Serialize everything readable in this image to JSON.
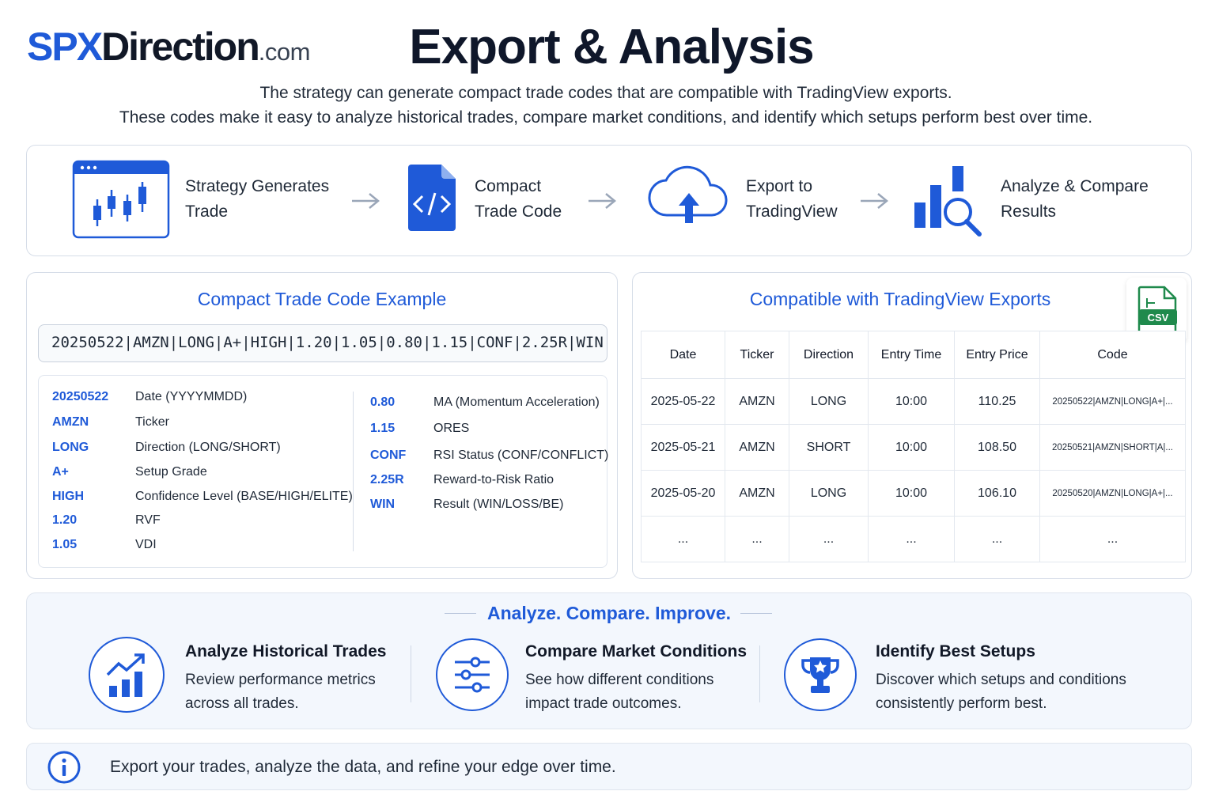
{
  "brand": {
    "part1": "SPX",
    "part2": "Direction",
    "part3": ".com"
  },
  "header": {
    "title": "Export & Analysis",
    "subtitle_line1": "The strategy can generate compact trade codes that are compatible with TradingView exports.",
    "subtitle_line2": "These codes make it easy to analyze historical trades, compare market conditions, and identify which setups perform best over time."
  },
  "flow": {
    "steps": [
      {
        "line1": "Strategy Generates",
        "line2": "Trade",
        "icon": "candlestick-chart-window-icon"
      },
      {
        "line1": "Compact",
        "line2": "Trade Code",
        "icon": "code-file-icon"
      },
      {
        "line1": "Export to",
        "line2": "TradingView",
        "icon": "cloud-upload-icon"
      },
      {
        "line1": "Analyze & Compare",
        "line2": "Results",
        "icon": "bar-chart-magnifier-icon"
      }
    ],
    "arrow_icon": "arrow-right-icon"
  },
  "code_example": {
    "title": "Compact Trade Code Example",
    "code": "20250522|AMZN|LONG|A+|HIGH|1.20|1.05|0.80|1.15|CONF|2.25R|WIN",
    "left_items": [
      {
        "key": "20250522",
        "desc": "Date (YYYYMMDD)"
      },
      {
        "key": "AMZN",
        "desc": "Ticker"
      },
      {
        "key": "LONG",
        "desc": "Direction (LONG/SHORT)"
      },
      {
        "key": "A+",
        "desc": "Setup Grade"
      },
      {
        "key": "HIGH",
        "desc": "Confidence Level (BASE/HIGH/ELITE)"
      },
      {
        "key": "1.20",
        "desc": "RVF"
      },
      {
        "key": "1.05",
        "desc": "VDI"
      }
    ],
    "right_items": [
      {
        "key": "0.80",
        "desc": "MA (Momentum Acceleration)"
      },
      {
        "key": "1.15",
        "desc": "ORES"
      },
      {
        "key": "CONF",
        "desc": "RSI Status (CONF/CONFLICT)"
      },
      {
        "key": "2.25R",
        "desc": "Reward-to-Risk Ratio"
      },
      {
        "key": "WIN",
        "desc": "Result (WIN/LOSS/BE)"
      }
    ]
  },
  "tv_export": {
    "title": "Compatible with TradingView Exports",
    "csv_label": "CSV",
    "columns": [
      "Date",
      "Ticker",
      "Direction",
      "Entry Time",
      "Entry Price",
      "Code"
    ],
    "rows": [
      [
        "2025-05-22",
        "AMZN",
        "LONG",
        "10:00",
        "110.25",
        "20250522|AMZN|LONG|A+|..."
      ],
      [
        "2025-05-21",
        "AMZN",
        "SHORT",
        "10:00",
        "108.50",
        "20250521|AMZN|SHORT|A|..."
      ],
      [
        "2025-05-20",
        "AMZN",
        "LONG",
        "10:00",
        "106.10",
        "20250520|AMZN|LONG|A+|..."
      ],
      [
        "...",
        "...",
        "...",
        "...",
        "...",
        "..."
      ]
    ]
  },
  "analyze": {
    "heading": "Analyze. Compare. Improve.",
    "features": [
      {
        "title": "Analyze Historical Trades",
        "desc1": "Review performance metrics",
        "desc2": "across all trades.",
        "icon": "trend-up-bar-chart-icon"
      },
      {
        "title": "Compare Market Conditions",
        "desc1": "See how different conditions",
        "desc2": "impact trade outcomes.",
        "icon": "sliders-icon"
      },
      {
        "title": "Identify Best Setups",
        "desc1": "Discover which setups and conditions",
        "desc2": "consistently perform best.",
        "icon": "trophy-star-icon"
      }
    ]
  },
  "info": {
    "text": "Export your trades, analyze the data, and refine your edge over time.",
    "icon": "info-circle-icon"
  },
  "colors": {
    "accent": "#1f5ad8",
    "text": "#1f2937",
    "panel_bg": "#f3f7fd",
    "border": "#d6dde8",
    "csv_green": "#1f8a4c"
  }
}
